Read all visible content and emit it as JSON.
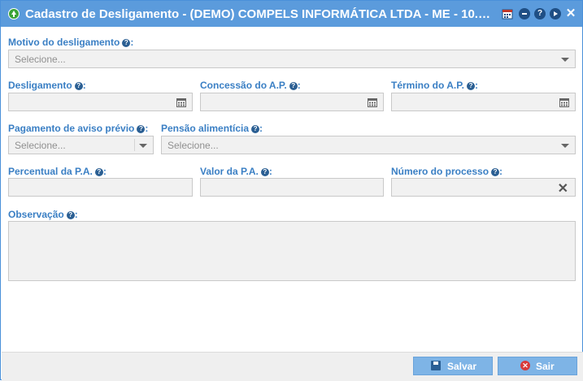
{
  "window": {
    "title": "Cadastro de Desligamento - (DEMO) COMPELS INFORMÁTICA LTDA - ME - 10.810....",
    "help_glyph": "?",
    "close_glyph": "✕"
  },
  "help_mark": "?",
  "form": {
    "motivo": {
      "label": "Motivo do desligamento",
      "placeholder": "Selecione..."
    },
    "desligamento": {
      "label": "Desligamento",
      "value": ""
    },
    "concessao": {
      "label": "Concessão do A.P.",
      "value": ""
    },
    "termino": {
      "label": "Término do A.P.",
      "value": ""
    },
    "aviso": {
      "label": "Pagamento de aviso prévio",
      "placeholder": "Selecione..."
    },
    "pensao": {
      "label": "Pensão alimentícia",
      "placeholder": "Selecione..."
    },
    "percentual": {
      "label": "Percentual da P.A.",
      "value": ""
    },
    "valor": {
      "label": "Valor da P.A.",
      "value": ""
    },
    "processo": {
      "label": "Número do processo",
      "value": "",
      "clear_glyph": "✕"
    },
    "observacao": {
      "label": "Observação",
      "value": ""
    },
    "label_suffix": ":"
  },
  "footer": {
    "save_label": "Salvar",
    "exit_label": "Sair",
    "exit_glyph": "✕"
  },
  "colors": {
    "titlebar": "#5b9bdc",
    "label": "#3a7fc4",
    "button": "#7eb4e6"
  }
}
